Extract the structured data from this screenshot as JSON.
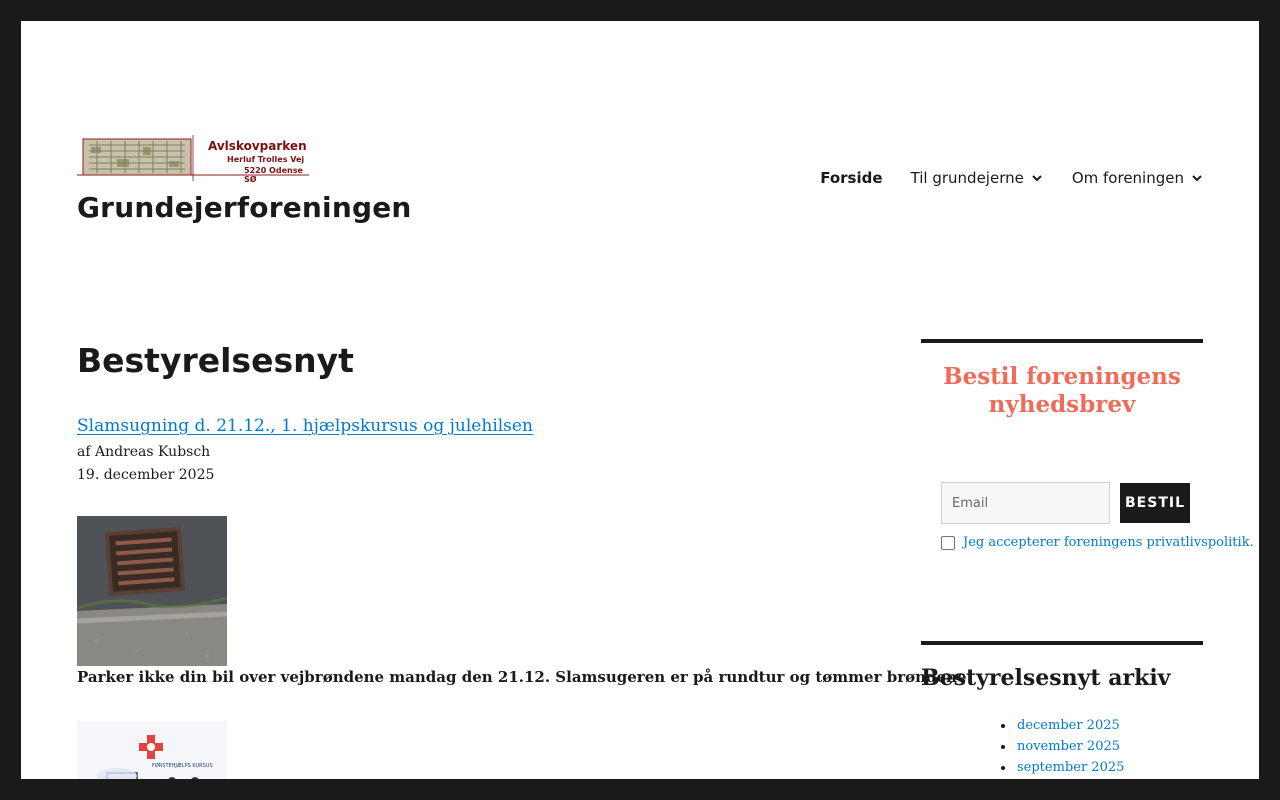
{
  "header": {
    "logo": {
      "title": "Avlskovparken",
      "line1": "Herluf Trolles Vej",
      "line2": "5220 Odense SØ"
    },
    "site_title": "Grundejerforeningen"
  },
  "nav": {
    "items": [
      {
        "label": "Forside",
        "active": true,
        "has_submenu": false
      },
      {
        "label": "Til grundejerne",
        "active": false,
        "has_submenu": true
      },
      {
        "label": "Om foreningen",
        "active": false,
        "has_submenu": true
      }
    ]
  },
  "main": {
    "heading": "Bestyrelsesnyt",
    "post": {
      "title": "Slamsugning d. 21.12., 1. hjælpskursus og julehilsen",
      "author": "af Andreas Kubsch",
      "date": "19. december 2025",
      "caption": "Parker ikke din bil over vejbrøndene mandag den 21.12. Slamsugeren er på rundtur og tømmer brøndene!",
      "second_image_text": "FØRSTEHJÆLPS KURSUS"
    }
  },
  "sidebar": {
    "newsletter": {
      "title": "Bestil foreningens nyhedsbrev",
      "email_placeholder": "Email",
      "submit_label": "BESTIL",
      "consent_label": "Jeg accepterer foreningens privatlivspolitik."
    },
    "archive": {
      "title": "Bestyrelsesnyt arkiv",
      "items": [
        "december 2025",
        "november 2025",
        "september 2025"
      ]
    }
  },
  "colors": {
    "frame": "#1a1a1a",
    "link": "#007acc",
    "newsletter_title": "#ef6b5a",
    "text": "#1a1a1a"
  }
}
